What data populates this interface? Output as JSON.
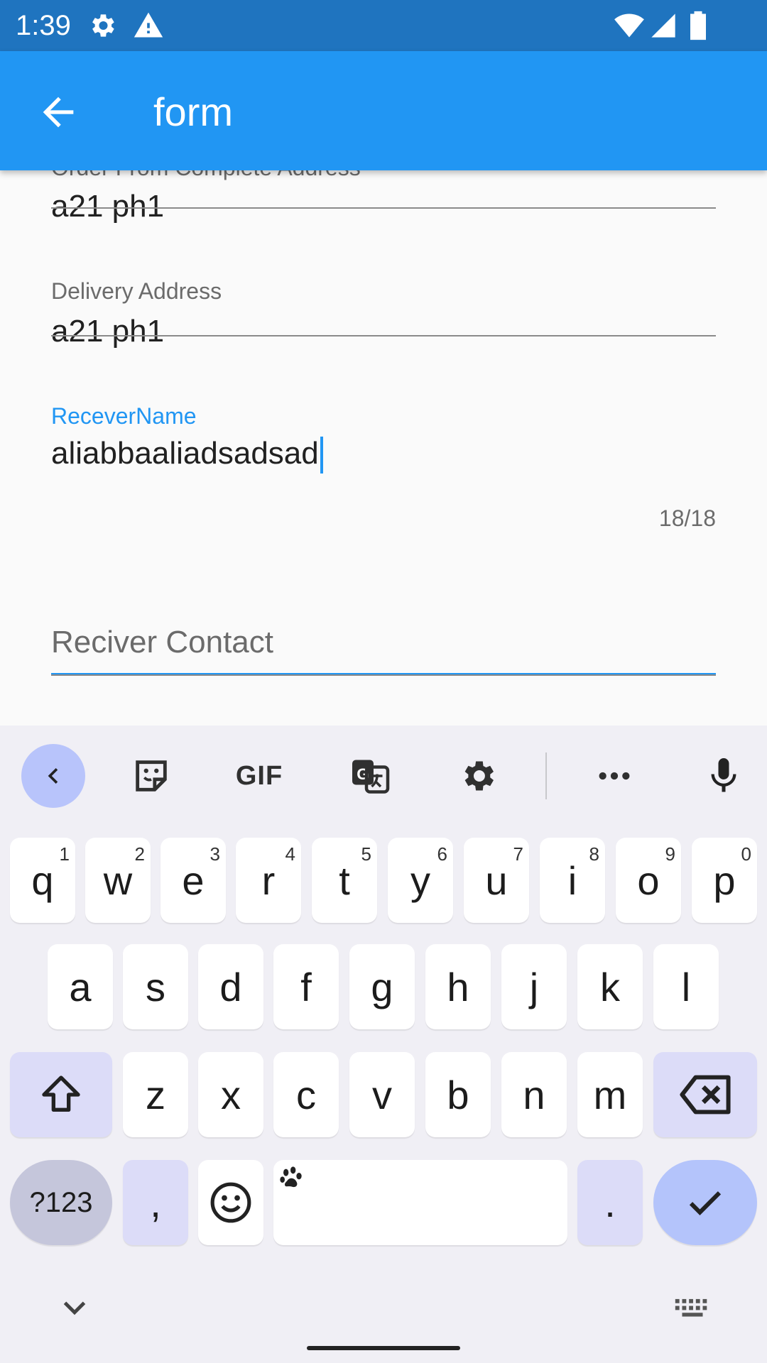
{
  "status_bar": {
    "time": "1:39",
    "icons": [
      "settings-gear-icon",
      "alert-triangle-icon",
      "wifi-icon",
      "cell-signal-icon",
      "battery-icon"
    ]
  },
  "app_bar": {
    "title": "form",
    "back_icon": "arrow-back-icon",
    "color": "#2196f3"
  },
  "form": {
    "fields": [
      {
        "label": "Order From Complete Address",
        "value": "a21 ph1"
      },
      {
        "label": "Delivery Address",
        "value": "a21 ph1"
      },
      {
        "label": "ReceverName",
        "value": "aliabbaaliadsadsad",
        "counter": "18/18",
        "focused": true
      },
      {
        "label": "Reciver Contact",
        "value": ""
      }
    ],
    "focus_color": "#2196f3"
  },
  "keyboard": {
    "toolbar": {
      "gif_label": "GIF",
      "icons": [
        "chevron-left-icon",
        "sticker-icon",
        "gif-icon",
        "translate-icon",
        "settings-gear-icon",
        "more-icon",
        "microphone-icon"
      ]
    },
    "row1": [
      {
        "key": "q",
        "hint": "1"
      },
      {
        "key": "w",
        "hint": "2"
      },
      {
        "key": "e",
        "hint": "3"
      },
      {
        "key": "r",
        "hint": "4"
      },
      {
        "key": "t",
        "hint": "5"
      },
      {
        "key": "y",
        "hint": "6"
      },
      {
        "key": "u",
        "hint": "7"
      },
      {
        "key": "i",
        "hint": "8"
      },
      {
        "key": "o",
        "hint": "9"
      },
      {
        "key": "p",
        "hint": "0"
      }
    ],
    "row2": [
      "a",
      "s",
      "d",
      "f",
      "g",
      "h",
      "j",
      "k",
      "l"
    ],
    "row3": [
      "z",
      "x",
      "c",
      "v",
      "b",
      "n",
      "m"
    ],
    "symbols_label": "?123",
    "comma_label": ",",
    "period_label": ".",
    "bottom_icons": [
      "shift-icon",
      "backspace-icon",
      "emoji-icon",
      "paw-icon",
      "check-icon",
      "chevron-down-icon",
      "keyboard-icon"
    ]
  }
}
